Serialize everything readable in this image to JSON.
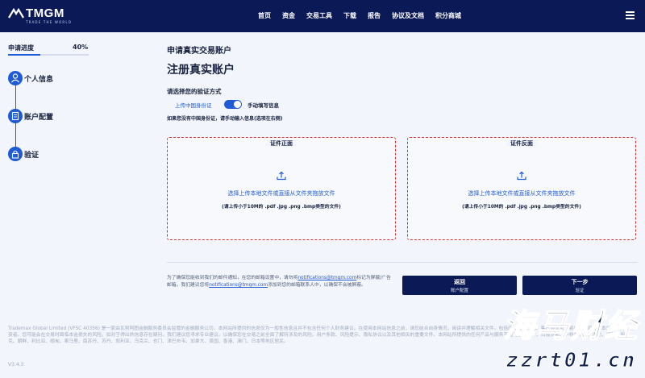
{
  "header": {
    "logo_text": "TMGM",
    "logo_tagline": "TRADE THE WORLD",
    "nav": [
      "首页",
      "资金",
      "交易工具",
      "下载",
      "报告",
      "协议及文档",
      "积分商城"
    ],
    "menu_icon": "hamburger-icon"
  },
  "sidebar": {
    "progress_label": "申请进度",
    "progress_value": "40%",
    "progress_fraction": 0.4,
    "steps": [
      {
        "label": "个人信息",
        "icon": "person-icon"
      },
      {
        "label": "账户配置",
        "icon": "document-icon"
      },
      {
        "label": "验证",
        "icon": "lock-icon"
      }
    ]
  },
  "main": {
    "pretitle": "申请真实交易账户",
    "title": "注册真实账户",
    "method_label": "请选择您的验证方式",
    "toggle_left": "上传中国身份证",
    "toggle_right": "手动填写信息",
    "note": "如果您没有中国身份证，请手动输入信息(选项在右侧)",
    "uploads": [
      {
        "title": "证件正面",
        "action": "选择上传本地文件或直接从文件夹拖放文件",
        "hint": "(请上传小于10M的 .pdf .jpg .png .bmp类型的文件)",
        "icon": "upload-icon"
      },
      {
        "title": "证件反面",
        "action": "选择上传本地文件或直接从文件夹拖放文件",
        "hint": "(请上传小于10M的 .pdf .jpg .png .bmp类型的文件)",
        "icon": "upload-icon"
      }
    ],
    "notice_part1": "为了确保您能收到我们的邮件通知，在您的邮箱设置中，请勿将",
    "notice_email": "notifications@tmgm.com",
    "notice_part2": "标记为屏蔽/广告邮箱。我们建议您将",
    "notice_email2": "notifications@tmgm.com",
    "notice_part3": "添加到您的邮箱联系人中，以确保不会被屏蔽。",
    "back_button": {
      "label": "返回",
      "sub": "账户配置"
    },
    "next_button": {
      "label": "下一步",
      "sub": "验证"
    }
  },
  "footer": {
    "disclaimer": "Trademax Global Limited (VFSC 40356) 是一家由瓦努阿图金融服务委员会监管的金融服务公司。本网站所提供的信息仅为一般性信息且并不包含任何个人财务建议。在使用本网站信息之前，请您结合自身情况，阅读并理解相关文件，包括产品披露声明、客户协议及交易条款及风险，本站适合所有投资者。您可能会在交易时面临本金损失的风险。如对于得出的信息存在疑问，我们建议您寻求专业建议。以确保您在交易之前全面了解所涉及的风险。用户条款、风险提示、隐私协议以及其他相关的重要文件。本网站所提供的任何产品与服务不适用于阿富汗、白俄罗斯、中非共和国、古巴、伊朗、伊拉克、朝鲜、利比亚、缅甸、索马里、南苏丹、苏丹、叙利亚、乌克兰、也门、津巴布韦、加拿大、美国、香港、澳门、日本等地区居民。",
    "version": "V3.4.3"
  },
  "watermark": {
    "title": "海马财经",
    "sub": "zzrt01.cn"
  },
  "colors": {
    "navy": "#0b1a57",
    "accent_blue": "#1f5bd6",
    "upload_border_red": "#d43030",
    "page_bg": "#f2f5fb"
  }
}
